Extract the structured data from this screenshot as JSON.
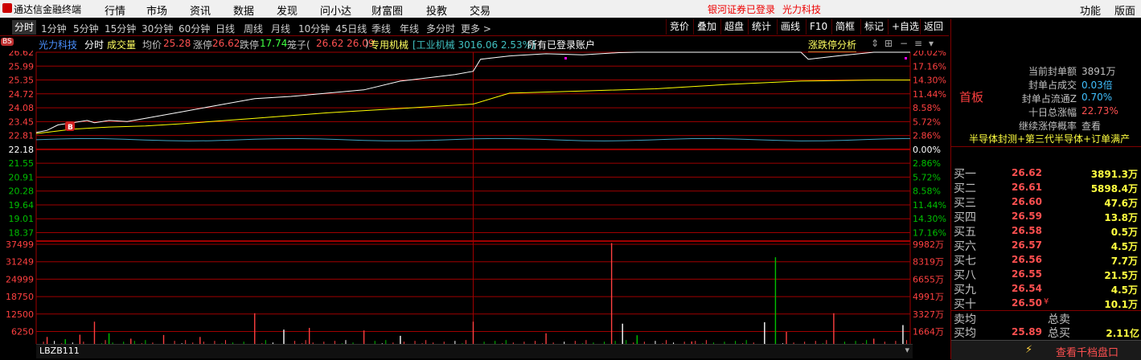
{
  "app": {
    "title": "通达信金融终端",
    "menus": [
      "行情",
      "市场",
      "资讯",
      "数据",
      "发现",
      "问小达",
      "财富圈",
      "投教",
      "交易"
    ],
    "login_status": "银河证券已登录",
    "stock_label": "光力科技",
    "right_menus": [
      "功能",
      "版面"
    ]
  },
  "toolbar": {
    "periods": [
      "分时",
      "1分钟",
      "5分钟",
      "15分钟",
      "30分钟",
      "60分钟",
      "日线",
      "周线",
      "月线",
      "10分钟",
      "45日线",
      "季线",
      "年线",
      "多分时",
      "更多 >"
    ],
    "active_period": "分时",
    "right_buttons": [
      "竞价",
      "叠加",
      "超盘",
      "统计",
      "画线",
      "F10",
      "简框",
      "标记",
      "+自选",
      "返回"
    ]
  },
  "infobar": {
    "bs_badge": "BS",
    "stock_name": "光力科技",
    "mode": "分时",
    "sub_mode": "成交量",
    "avg_label": "均价",
    "avg_value": "25.28",
    "limit_up_label": "涨停",
    "limit_up_value": "26.62",
    "limit_down_label": "跌停",
    "limit_down_value": "17.74",
    "cage_label": "笼子(",
    "cage_value": "26.62 26.09",
    "cage_close": ")",
    "sector": "专用机械",
    "index_text": "[工业机械 3016.06 2.53%]",
    "accounts": "所有已登录账户",
    "limit_analysis": "涨跌停分析",
    "marker_b": "B"
  },
  "price_axis": {
    "left": [
      "26.62",
      "25.99",
      "25.35",
      "24.72",
      "24.08",
      "23.45",
      "22.81",
      "22.18",
      "21.55",
      "20.91",
      "20.28",
      "19.64",
      "19.01",
      "18.37"
    ],
    "right": [
      "20.02%",
      "17.16%",
      "14.30%",
      "11.44%",
      "8.58%",
      "5.72%",
      "2.86%",
      "0.00%",
      "2.86%",
      "5.72%",
      "8.58%",
      "11.44%",
      "14.30%",
      "17.16%"
    ],
    "prev_close": "22.18",
    "limit_up": 26.62,
    "limit_down": 17.74
  },
  "volume_axis": {
    "left": [
      "37499",
      "31249",
      "24999",
      "18750",
      "12500",
      "6250"
    ],
    "right": [
      "9982万",
      "8319万",
      "6655万",
      "4991万",
      "3327万",
      "1664万"
    ]
  },
  "chart_data": {
    "type": "line",
    "title": "",
    "ylim": [
      17.74,
      26.62
    ],
    "series": [
      {
        "name": "",
        "color": "#ffffff",
        "x": [
          0,
          3,
          6,
          10,
          14,
          16,
          20,
          25,
          30,
          40,
          50,
          60,
          70,
          80,
          90,
          100,
          110,
          115,
          120,
          122,
          130,
          140,
          150,
          160,
          165,
          170,
          180,
          190,
          200,
          210,
          212,
          220,
          230,
          240
        ],
        "values": [
          22.95,
          23.05,
          23.3,
          23.4,
          23.5,
          23.4,
          23.5,
          23.45,
          23.6,
          23.9,
          24.2,
          24.5,
          24.6,
          24.75,
          24.9,
          25.3,
          25.5,
          25.6,
          25.75,
          26.3,
          26.45,
          26.55,
          26.5,
          26.6,
          26.62,
          26.62,
          26.62,
          26.62,
          26.62,
          26.62,
          26.3,
          26.45,
          26.62,
          26.62
        ]
      },
      {
        "name": "",
        "color": "#ffff00",
        "x": [
          0,
          10,
          20,
          30,
          40,
          60,
          80,
          100,
          120,
          130,
          150,
          170,
          190,
          210,
          230,
          240
        ],
        "values": [
          22.9,
          23.1,
          23.2,
          23.25,
          23.35,
          23.6,
          23.85,
          24.05,
          24.25,
          24.75,
          24.85,
          24.95,
          25.15,
          25.3,
          25.35,
          25.35
        ]
      }
    ],
    "volume": {
      "ylim": [
        0,
        43749
      ],
      "bars": [
        {
          "x": 3,
          "v": 4800,
          "c": "red"
        },
        {
          "x": 8,
          "v": 4000,
          "c": "green"
        },
        {
          "x": 12,
          "v": 5600,
          "c": "red"
        },
        {
          "x": 16,
          "v": 10200,
          "c": "red"
        },
        {
          "x": 20,
          "v": 6100,
          "c": "green"
        },
        {
          "x": 26,
          "v": 4200,
          "c": "red"
        },
        {
          "x": 35,
          "v": 5500,
          "c": "red"
        },
        {
          "x": 45,
          "v": 4800,
          "c": "red"
        },
        {
          "x": 60,
          "v": 13200,
          "c": "red"
        },
        {
          "x": 68,
          "v": 7400,
          "c": "white"
        },
        {
          "x": 75,
          "v": 8000,
          "c": "red"
        },
        {
          "x": 90,
          "v": 7100,
          "c": "red"
        },
        {
          "x": 100,
          "v": 5200,
          "c": "white"
        },
        {
          "x": 120,
          "v": 10200,
          "c": "red"
        },
        {
          "x": 140,
          "v": 6100,
          "c": "red"
        },
        {
          "x": 158,
          "v": 38000,
          "c": "red"
        },
        {
          "x": 161,
          "v": 9500,
          "c": "white"
        },
        {
          "x": 165,
          "v": 5400,
          "c": "green"
        },
        {
          "x": 180,
          "v": 3200,
          "c": "red"
        },
        {
          "x": 200,
          "v": 10000,
          "c": "white"
        },
        {
          "x": 203,
          "v": 33000,
          "c": "green"
        },
        {
          "x": 206,
          "v": 6600,
          "c": "red"
        },
        {
          "x": 219,
          "v": 13200,
          "c": "red"
        },
        {
          "x": 230,
          "v": 4200,
          "c": "red"
        },
        {
          "x": 238,
          "v": 9000,
          "c": "white"
        }
      ]
    }
  },
  "bottom_tab": {
    "name": "LBZB111"
  },
  "right_panel": {
    "first_board": "首板",
    "stats": [
      {
        "label": "当前封单额",
        "value": "3891万"
      },
      {
        "label": "封单占成交",
        "value": "0.03倍"
      },
      {
        "label": "封单占流通Z",
        "value": "0.70%"
      },
      {
        "label": "十日总涨幅",
        "value": "22.73%"
      },
      {
        "label": "继续涨停概率",
        "value": "查看"
      }
    ],
    "theme": "半导体封测+第三代半导体+订单满产",
    "orders": [
      {
        "label": "买一",
        "price": "26.62",
        "vol": "3891.3万"
      },
      {
        "label": "买二",
        "price": "26.61",
        "vol": "5898.4万"
      },
      {
        "label": "买三",
        "price": "26.60",
        "vol": "47.6万"
      },
      {
        "label": "买四",
        "price": "26.59",
        "vol": "13.8万"
      },
      {
        "label": "买五",
        "price": "26.58",
        "vol": "0.5万"
      },
      {
        "label": "买六",
        "price": "26.57",
        "vol": "4.5万"
      },
      {
        "label": "买七",
        "price": "26.56",
        "vol": "7.7万"
      },
      {
        "label": "买八",
        "price": "26.55",
        "vol": "21.5万"
      },
      {
        "label": "买九",
        "price": "26.54",
        "vol": "4.5万"
      },
      {
        "label": "买十",
        "price": "26.50",
        "vol": "10.1万",
        "mark": "¥"
      }
    ],
    "sell_avg_label": "卖均",
    "total_sell_label": "总卖",
    "buy_avg_label": "买均",
    "buy_avg_value": "25.89",
    "total_buy_label": "总买",
    "total_buy_value": "2.11亿",
    "check_button": "查看千档盘口"
  },
  "colors": {
    "grid": "#a00000",
    "up": "#ff4040",
    "down": "#00c000",
    "price_line": "#ffffff",
    "avg_line": "#ffff00",
    "index_line": "#40a0c0"
  }
}
